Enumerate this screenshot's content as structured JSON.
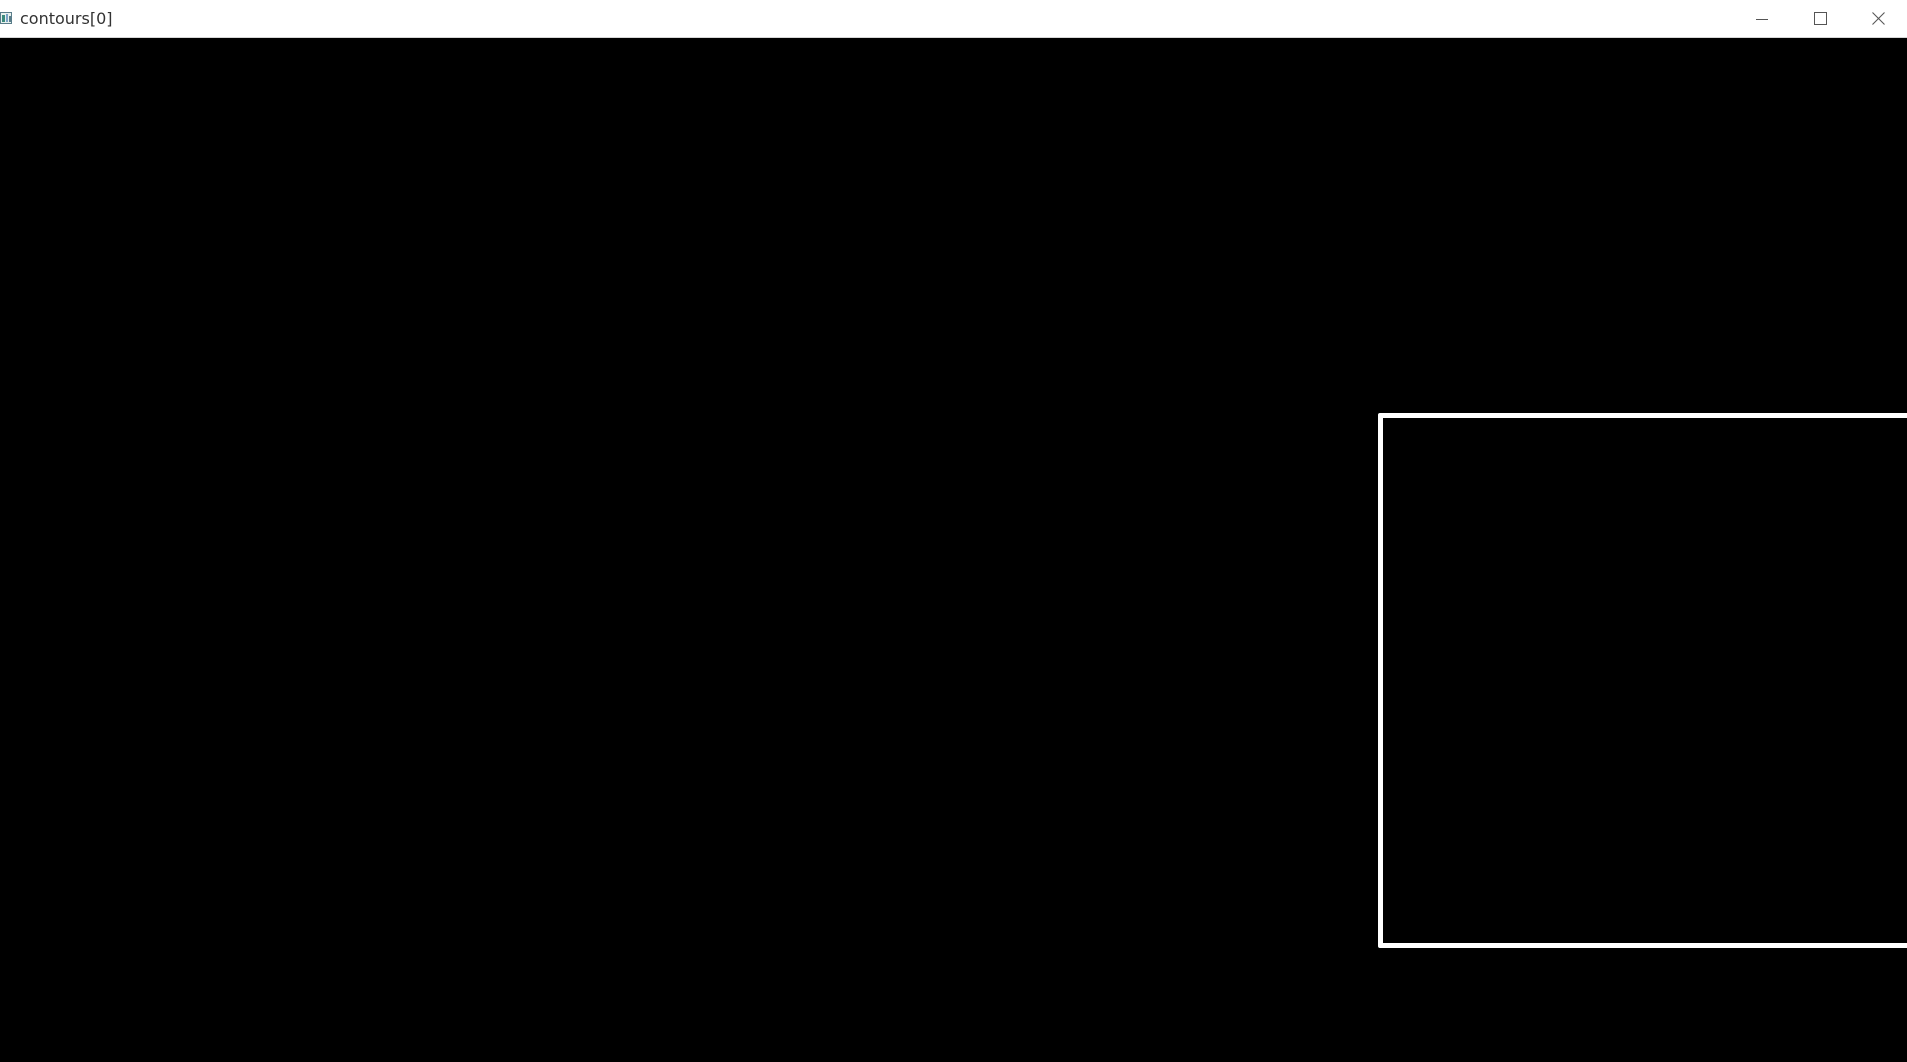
{
  "window": {
    "title": "contours[0]",
    "controls": {
      "minimize_icon": "minimize-icon",
      "maximize_icon": "maximize-icon",
      "close_icon": "close-icon"
    }
  },
  "canvas": {
    "background_color": "#000000",
    "contour_color": "#ffffff"
  }
}
